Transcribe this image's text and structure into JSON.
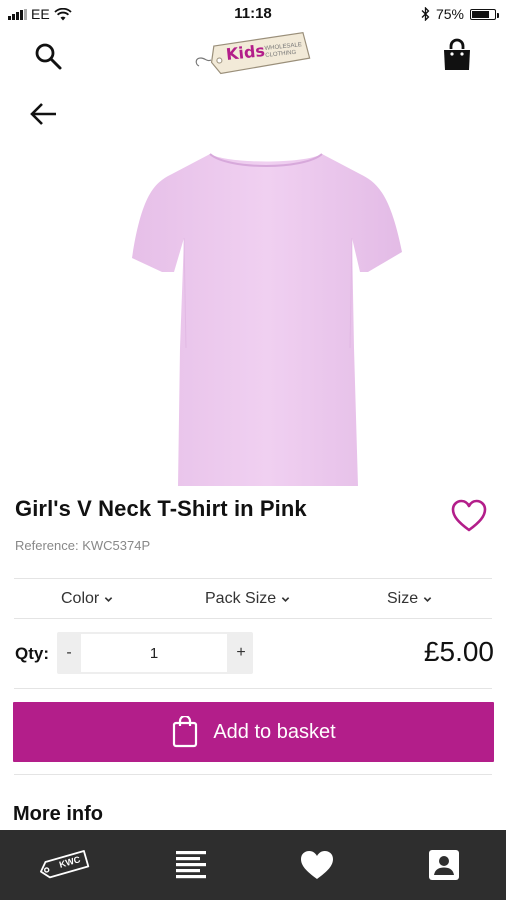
{
  "status_bar": {
    "carrier": "EE",
    "time": "11:18",
    "battery_percent": "75%",
    "battery_level": 0.75
  },
  "header": {
    "logo_text": "Kids",
    "logo_subtext": "WHOLESALE CLOTHING",
    "icons": [
      "search-icon",
      "shopping-bag-icon"
    ]
  },
  "product": {
    "title": "Girl's V Neck T-Shirt in Pink",
    "reference": "Reference: KWC5374P",
    "image_color": "#ecc8ee",
    "options": {
      "color_label": "Color",
      "pack_size_label": "Pack Size",
      "size_label": "Size"
    },
    "qty_label": "Qty:",
    "qty_minus": "-",
    "qty_value": "1",
    "qty_plus": "+",
    "price": "£5.00"
  },
  "actions": {
    "add_to_basket": "Add to basket"
  },
  "more_info_label": "More info",
  "bottom_nav": {
    "tabs": [
      "kwc-tag-icon",
      "list-icon",
      "heart-icon",
      "account-icon"
    ],
    "kwc_text": "KWC"
  },
  "colors": {
    "accent": "#b31e8a",
    "bottom_bar": "#2e2e2e"
  }
}
